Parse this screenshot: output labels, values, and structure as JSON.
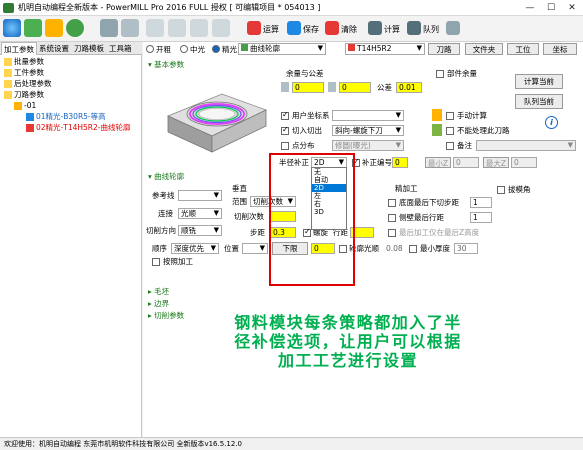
{
  "window": {
    "title": "机明自动编程全新版本 - PowerMILL Pro 2016 FULL 授权  [ 可编辑项目 * 054013 ]",
    "min": "—",
    "max": "☐",
    "close": "✕"
  },
  "toolbar": {
    "labels": [
      "运算",
      "保存",
      "清除",
      "计算",
      "队列"
    ],
    "accent": "#2e8b57"
  },
  "left_panel": {
    "tabs": [
      "加工参数",
      "系统设置",
      "刀路模板",
      "工具箱"
    ],
    "tree": [
      {
        "label": "批量参数"
      },
      {
        "label": "工件参数"
      },
      {
        "label": "后处理参数"
      },
      {
        "label": "刀路参数"
      },
      {
        "label": "-01"
      },
      {
        "label": "01精光-B30R5-等高"
      },
      {
        "label": "02精光-T14H5R2-曲线轮廓"
      }
    ]
  },
  "top_row": {
    "radio_rough": "开粗",
    "radio_mid": "中光",
    "radio_finish": "精光",
    "strategy": "曲线轮廓",
    "tool": "T14H5R2",
    "tool_path_btn": "刀路",
    "folder_btn": "文件夹",
    "workpiece_btn": "工位",
    "coord_btn": "坐标"
  },
  "sections": {
    "basic": "基本参数",
    "curve": "曲线轮廓",
    "blank": "毛坯",
    "edge": "边界",
    "cut": "切削参数"
  },
  "allowance": {
    "title": "余量与公差",
    "v1": "0",
    "v2": "0",
    "tol_label": "公差",
    "tol": "0.01",
    "part_allow": "部件余量"
  },
  "right_buttons": {
    "calc_now": "计算当前",
    "queue_now": "队列当前",
    "info": "i"
  },
  "options": {
    "user_coord": "用户坐标系",
    "cut_in": "切入切出",
    "cut_in_val": "斜向-螺旋下刀",
    "point_dist": "点分布",
    "point_dist_val": "修圆(曝光)",
    "manual_calc": "手动计算",
    "no_link": "不能处理此刀路",
    "note": "备注"
  },
  "radius": {
    "label": "半径补正",
    "value": "2D",
    "comp_cb": "补正编号",
    "comp_no": "0",
    "min_label": "最小Z",
    "min_val": "0",
    "max_label": "最大Z",
    "max_val": "0",
    "options": [
      "无",
      "自动",
      "2D",
      "左",
      "右",
      "3D"
    ]
  },
  "curve_form": {
    "ref": "参考线",
    "connect": "连接",
    "connect_val": "光顺",
    "cut_dir": "切削方向",
    "cut_dir_val": "顺铣",
    "vertical": "垂直",
    "range": "范围",
    "range_val": "切削次数",
    "cut_times": "切削次数",
    "step": "步距",
    "step_val": "0.3",
    "spiral": "螺旋",
    "row": "行距",
    "sequence": "顺序",
    "sequence_val": "深度优先",
    "position": "位置",
    "down": "下限",
    "down_val": "0",
    "outline": "轮廓光顺",
    "outline_val": "0.08",
    "min_thick": "最小厚度",
    "min_thick_val": "30",
    "keep_machining": "按照加工",
    "thin_process": "精加工",
    "bottom_down": "底面最后下切步距",
    "bottom_down_val": "1",
    "side_last": "侧壁最后行距",
    "side_last_val": "1",
    "only_last": "最后加工仅在最后Z高度",
    "chamfer": "拔模角"
  },
  "overlay": {
    "line1": "钢料模块每条策略都加入了半",
    "line2": "径补偿选项，让用户可以根据",
    "line3": "加工工艺进行设置",
    "color": "#00b050"
  },
  "status": "欢迎使用：机明自动编程 东莞市机明软件科技有限公司 全新版本v16.5.12.0"
}
